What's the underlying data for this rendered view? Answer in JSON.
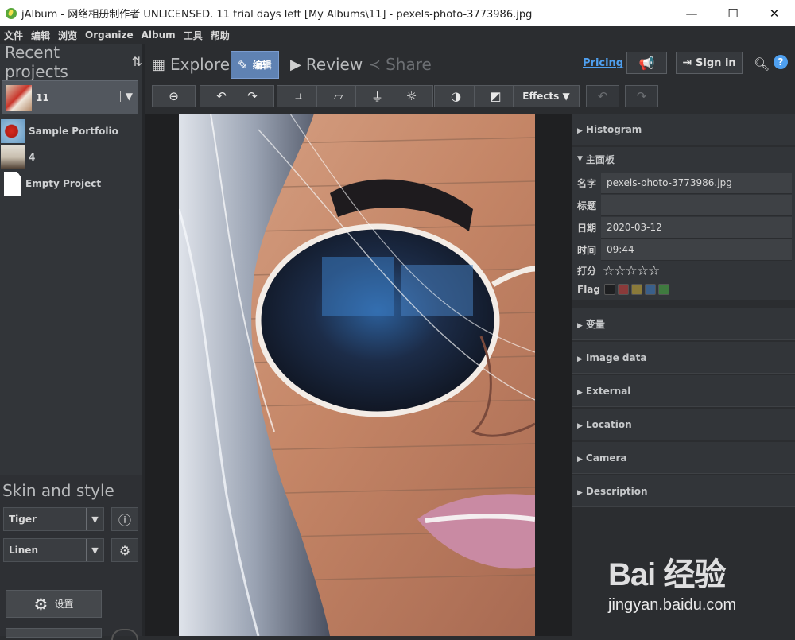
{
  "window": {
    "title": "jAlbum - 网络相册制作者 UNLICENSED. 11 trial days left [My Albums\\11] - pexels-photo-3773986.jpg",
    "minimize": "—",
    "maximize": "☐",
    "close": "✕"
  },
  "menu": [
    "文件",
    "编辑",
    "浏览",
    "Organize",
    "Album",
    "工具",
    "帮助"
  ],
  "left_panel": {
    "header": "Recent projects",
    "selected_project": "11",
    "projects": [
      {
        "name": "Sample Portfolio"
      },
      {
        "name": "4"
      },
      {
        "name": "Empty Project"
      }
    ],
    "skin_title": "Skin and style",
    "skin": "Tiger",
    "style": "Linen",
    "settings_label": "设置"
  },
  "nav": {
    "explore": "Explore",
    "edit": "编辑",
    "review": "Review",
    "share": "Share",
    "pricing": "Pricing",
    "signin": "Sign in",
    "help": "?"
  },
  "toolbar": {
    "effects": "Effects ▼"
  },
  "right_panel": {
    "histogram": "Histogram",
    "main_panel": "主面板",
    "fields": [
      {
        "key": "名字",
        "value": "pexels-photo-3773986.jpg"
      },
      {
        "key": "标题",
        "value": ""
      },
      {
        "key": "日期",
        "value": "2020-03-12"
      },
      {
        "key": "时间",
        "value": "09:44"
      }
    ],
    "rating_label": "打分",
    "rating": "☆☆☆☆☆",
    "flag_label": "Flag",
    "flag_colors": [
      "#1e1f21",
      "#8a3a3a",
      "#8a7a3a",
      "#3a5f8a",
      "#3f7a3f"
    ],
    "sections": [
      "变量",
      "Image data",
      "External",
      "Location",
      "Camera",
      "Description"
    ]
  },
  "watermark": {
    "logo": "Bai 经验",
    "url": "jingyan.baidu.com"
  }
}
